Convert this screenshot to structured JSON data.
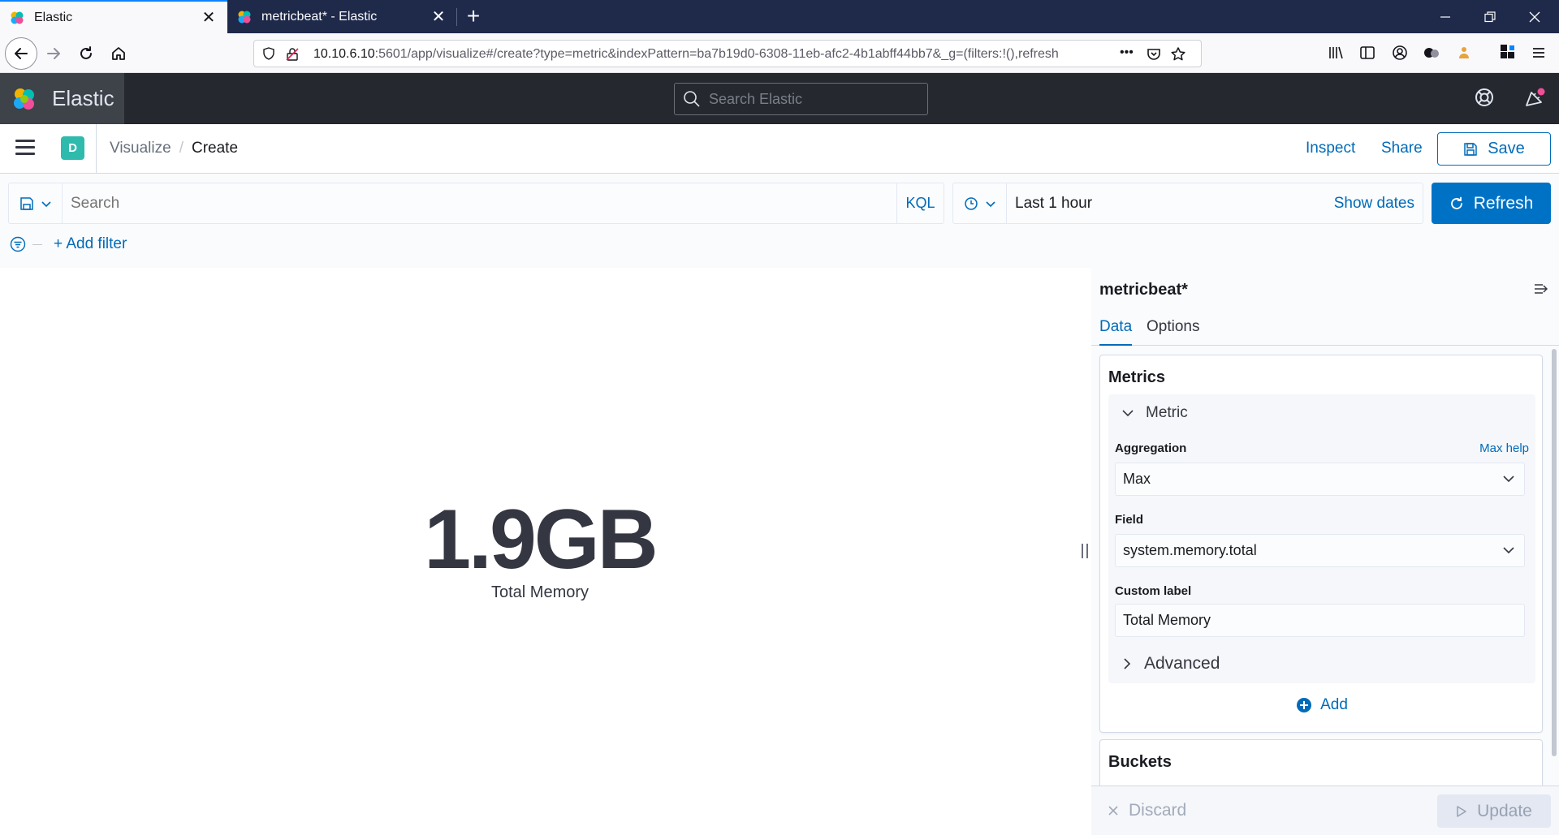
{
  "browser": {
    "tabs": [
      {
        "title": "Elastic",
        "active": true
      },
      {
        "title": "metricbeat* - Elastic",
        "active": false
      }
    ],
    "url_host": "10.10.6.10",
    "url_rest": ":5601/app/visualize#/create?type=metric&indexPattern=ba7b19d0-6308-11eb-afc2-4b1abff44bb7&_g=(filters:!(),refresh",
    "more_label": "•••"
  },
  "kibana_header": {
    "brand": "Elastic",
    "search_placeholder": "Search Elastic"
  },
  "subnav": {
    "space_initial": "D",
    "breadcrumbs": [
      "Visualize",
      "Create"
    ],
    "inspect_label": "Inspect",
    "share_label": "Share",
    "save_label": "Save"
  },
  "querybar": {
    "search_placeholder": "Search",
    "kql_label": "KQL",
    "date_range": "Last 1 hour",
    "show_dates_label": "Show dates",
    "refresh_label": "Refresh",
    "add_filter_label": "+ Add filter"
  },
  "visualization": {
    "value": "1.9GB",
    "label": "Total Memory"
  },
  "sidebar": {
    "index_pattern": "metricbeat*",
    "tabs": [
      "Data",
      "Options"
    ],
    "metrics_title": "Metrics",
    "metric_header": "Metric",
    "aggregation_label": "Aggregation",
    "aggregation_help": "Max help",
    "aggregation_value": "Max",
    "field_label": "Field",
    "field_value": "system.memory.total",
    "custom_label_label": "Custom label",
    "custom_label_value": "Total Memory",
    "advanced_label": "Advanced",
    "add_label": "Add",
    "buckets_title": "Buckets",
    "discard_label": "Discard",
    "update_label": "Update"
  },
  "colors": {
    "accent": "#006bb8",
    "header_bg": "#25282f",
    "refresh_bg": "#0072c6",
    "space_avatar": "#2ebbad"
  }
}
